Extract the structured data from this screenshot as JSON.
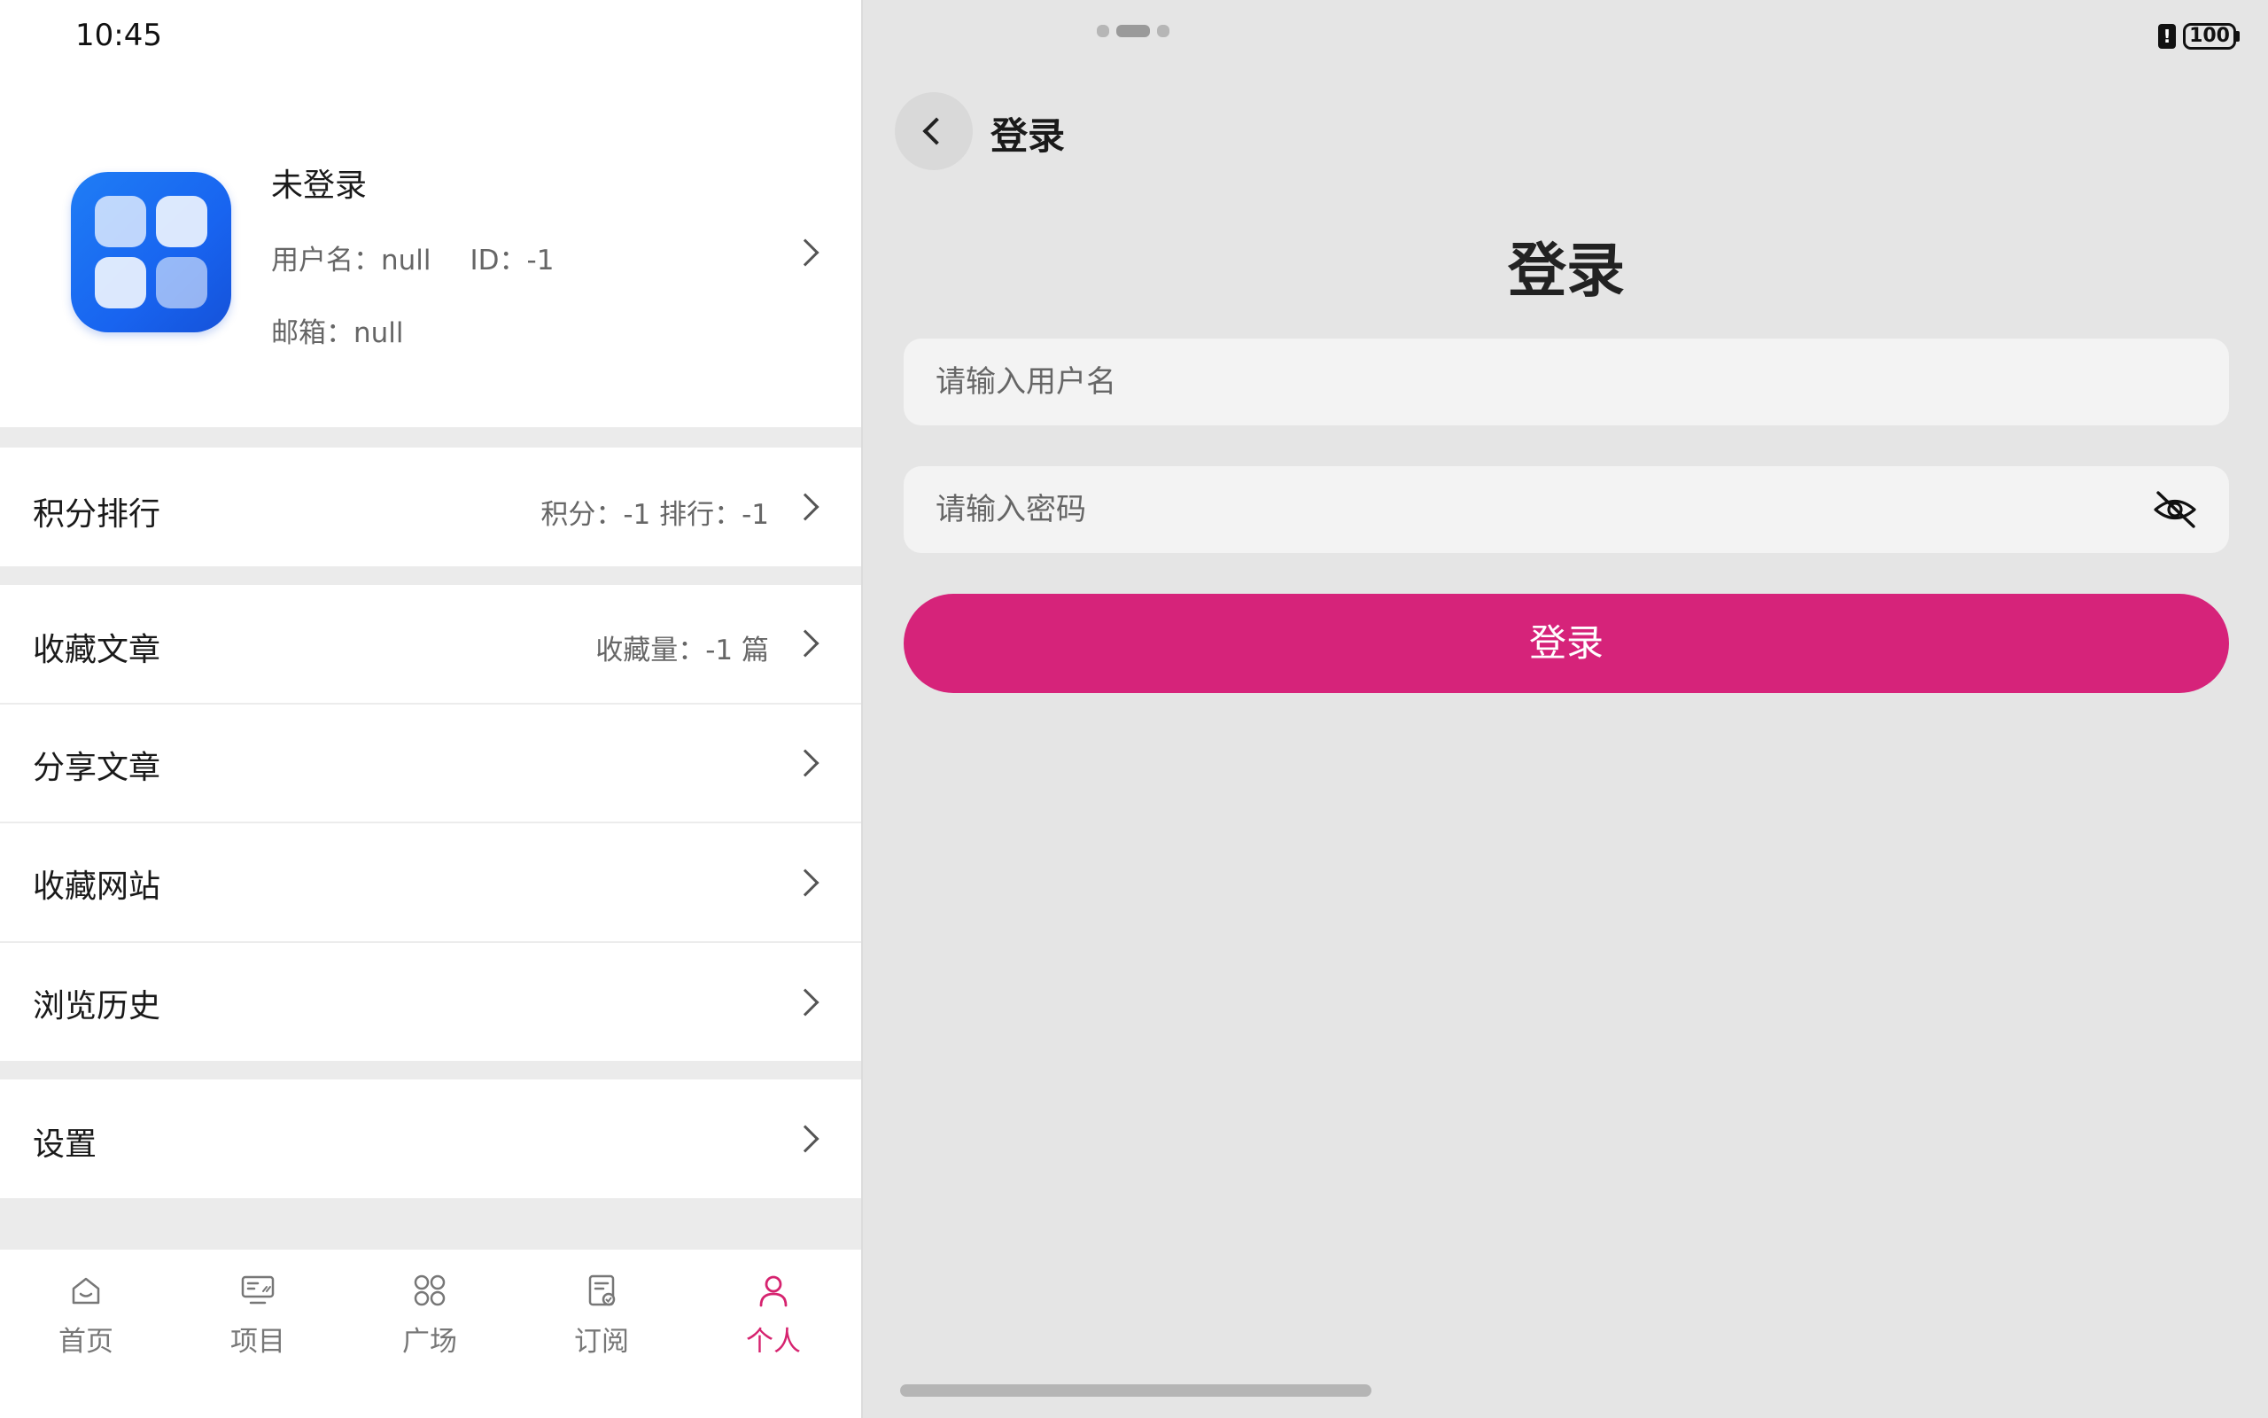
{
  "status_bar": {
    "time": "10:45",
    "battery": "100"
  },
  "profile": {
    "name": "未登录",
    "username_label": "用户名：null",
    "id_label": "ID：-1",
    "email_label": "邮箱：null"
  },
  "menu": {
    "points_rank": {
      "label": "积分排行",
      "extra": "积分：-1   排行：-1"
    },
    "favorite_articles": {
      "label": "收藏文章",
      "extra": "收藏量：-1 篇"
    },
    "share_articles": {
      "label": "分享文章"
    },
    "favorite_sites": {
      "label": "收藏网站"
    },
    "browse_history": {
      "label": "浏览历史"
    },
    "settings": {
      "label": "设置"
    }
  },
  "tabs": [
    {
      "label": "首页",
      "icon": "home-icon"
    },
    {
      "label": "项目",
      "icon": "project-icon"
    },
    {
      "label": "广场",
      "icon": "square-grid-icon"
    },
    {
      "label": "订阅",
      "icon": "subscribe-icon"
    },
    {
      "label": "个人",
      "icon": "person-icon",
      "active": true
    }
  ],
  "login_page": {
    "nav_title": "登录",
    "heading": "登录",
    "username_placeholder": "请输入用户名",
    "password_placeholder": "请输入密码",
    "submit_label": "登录"
  },
  "colors": {
    "accent": "#d6237a",
    "logo_blue": "#1864f0"
  }
}
